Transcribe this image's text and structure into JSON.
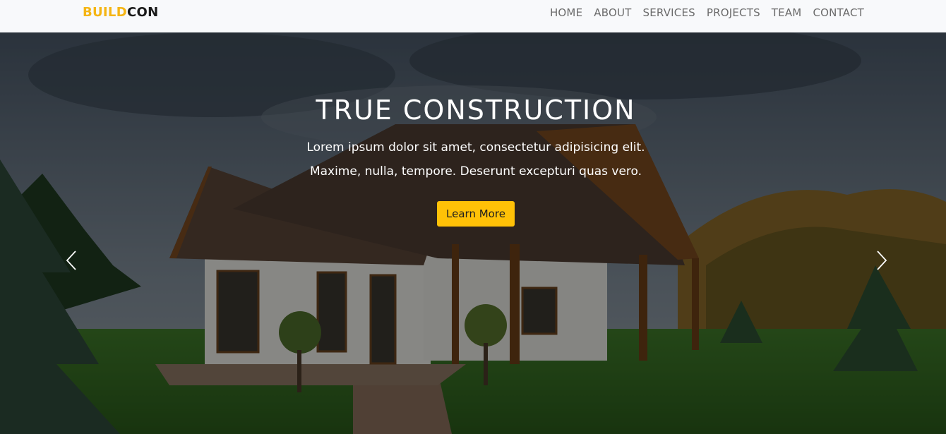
{
  "brand": {
    "part1": "BUILD",
    "part2": "CON"
  },
  "nav": {
    "items": [
      "HOME",
      "ABOUT",
      "SERVICES",
      "PROJECTS",
      "TEAM",
      "CONTACT"
    ]
  },
  "hero": {
    "title": "TRUE CONSTRUCTION",
    "line1": "Lorem ipsum dolor sit amet, consectetur adipisicing elit.",
    "line2": "Maxime, nulla, tempore. Deserunt excepturi quas vero.",
    "button_label": "Learn More",
    "prev_icon": "chevron-left",
    "next_icon": "chevron-right"
  },
  "colors": {
    "accent": "#ffc107",
    "brand_yellow": "#f5b514",
    "nav_bg": "#f8f9fb"
  }
}
